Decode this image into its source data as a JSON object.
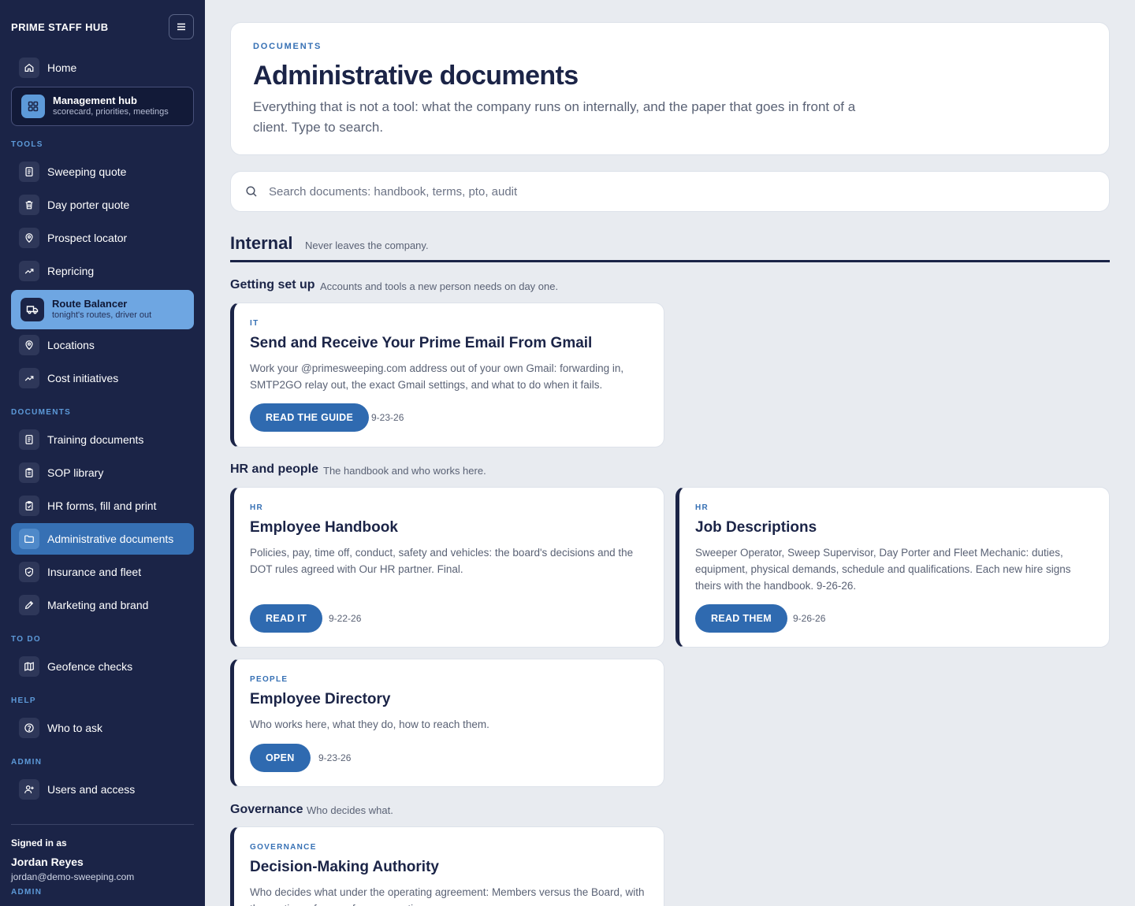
{
  "sidebar": {
    "brand": "PRIME STAFF HUB",
    "home": "Home",
    "mgmt": {
      "title": "Management hub",
      "subtitle": "scorecard, priorities, meetings"
    },
    "sections": {
      "tools": "TOOLS",
      "documents": "DOCUMENTS",
      "todo": "TO DO",
      "help": "HELP",
      "admin": "ADMIN"
    },
    "tools": [
      {
        "label": "Sweeping quote",
        "icon": "document-icon"
      },
      {
        "label": "Day porter quote",
        "icon": "trash-icon"
      },
      {
        "label": "Prospect locator",
        "icon": "map-pin-icon"
      },
      {
        "label": "Repricing",
        "icon": "trend-up-icon"
      }
    ],
    "route": {
      "title": "Route Balancer",
      "subtitle": "tonight's routes, driver out"
    },
    "tools2": [
      {
        "label": "Locations",
        "icon": "map-pin-icon"
      },
      {
        "label": "Cost initiatives",
        "icon": "trend-up-icon"
      }
    ],
    "documents": [
      {
        "label": "Training documents",
        "icon": "document-icon"
      },
      {
        "label": "SOP library",
        "icon": "clipboard-icon"
      },
      {
        "label": "HR forms, fill and print",
        "icon": "clipboard-check-icon"
      },
      {
        "label": "Administrative documents",
        "icon": "folder-icon"
      },
      {
        "label": "Insurance and fleet",
        "icon": "shield-icon"
      },
      {
        "label": "Marketing and brand",
        "icon": "pencil-icon"
      }
    ],
    "todo": [
      {
        "label": "Geofence checks",
        "icon": "map-icon"
      }
    ],
    "help": [
      {
        "label": "Who to ask",
        "icon": "question-icon"
      }
    ],
    "admin": [
      {
        "label": "Users and access",
        "icon": "user-plus-icon"
      }
    ],
    "user": {
      "signed_as": "Signed in as",
      "name": "Jordan Reyes",
      "email": "jordan@demo-sweeping.com",
      "role": "ADMIN"
    }
  },
  "header": {
    "eyebrow": "DOCUMENTS",
    "title": "Administrative documents",
    "description": "Everything that is not a tool: what the company runs on internally, and the paper that goes in front of a client. Type to search."
  },
  "search": {
    "placeholder": "Search documents: handbook, terms, pto, audit"
  },
  "section": {
    "title": "Internal",
    "subtitle": "Never leaves the company."
  },
  "groups": {
    "setup": {
      "title": "Getting set up",
      "subtitle": "Accounts and tools a new person needs on day one."
    },
    "hr": {
      "title": "HR and people",
      "subtitle": "The handbook and who works here."
    },
    "gov": {
      "title": "Governance",
      "subtitle": "Who decides what."
    }
  },
  "cards": {
    "gmail": {
      "tag": "IT",
      "title": "Send and Receive Your Prime Email From Gmail",
      "desc": "Work your @primesweeping.com address out of your own Gmail: forwarding in, SMTP2GO relay out, the exact Gmail settings, and what to do when it fails.",
      "button": "READ THE GUIDE",
      "date": "9-23-26"
    },
    "handbook": {
      "tag": "HR",
      "title": "Employee Handbook",
      "desc": "Policies, pay, time off, conduct, safety and vehicles: the board's decisions and the DOT rules agreed with Our HR partner. Final.",
      "button": "READ IT",
      "date": "9-22-26"
    },
    "jobs": {
      "tag": "HR",
      "title": "Job Descriptions",
      "desc": "Sweeper Operator, Sweep Supervisor, Day Porter and Fleet Mechanic: duties, equipment, physical demands, schedule and qualifications. Each new hire signs theirs with the handbook. 9-26-26.",
      "button": "READ THEM",
      "date": "9-26-26"
    },
    "directory": {
      "tag": "PEOPLE",
      "title": "Employee Directory",
      "desc": "Who works here, what they do, how to reach them.",
      "button": "OPEN",
      "date": "9-23-26"
    },
    "authority": {
      "tag": "GOVERNANCE",
      "title": "Decision-Making Authority",
      "desc": "Who decides what under the operating agreement: Members versus the Board, with the section reference for every action."
    }
  }
}
